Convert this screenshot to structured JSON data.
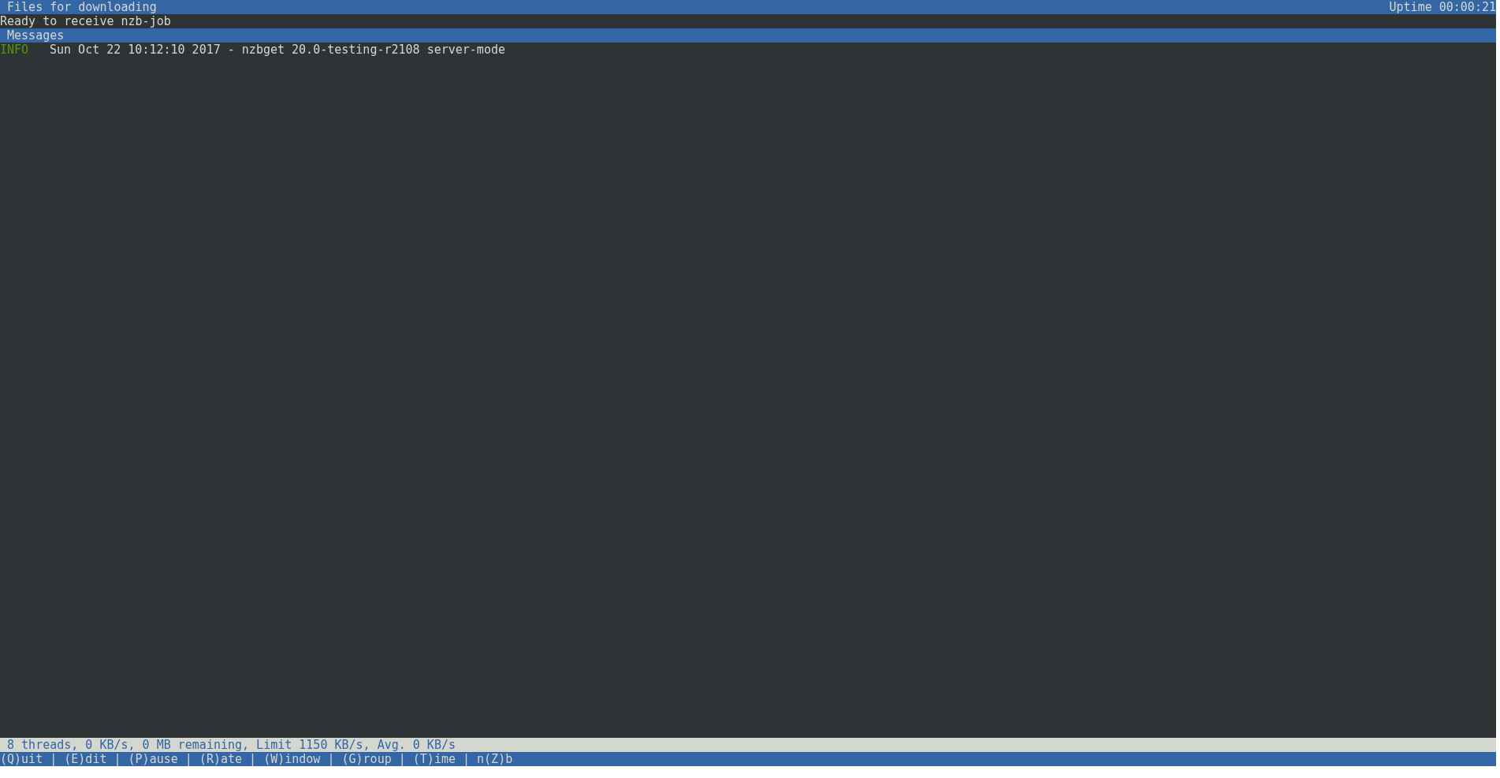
{
  "title_bar": {
    "title": "Files for downloading",
    "uptime": "Uptime 00:00:21"
  },
  "queue_status": "Ready to receive nzb-job",
  "messages": {
    "title": "Messages",
    "entries": [
      {
        "severity": "INFO",
        "color": "#4e9a06",
        "text": "Sun Oct 22 10:12:10 2017 - nzbget 20.0-testing-r2108 server-mode"
      }
    ]
  },
  "status_bar": "8 threads, 0 KB/s, 0 MB remaining, Limit 1150 KB/s, Avg. 0 KB/s",
  "key_bar": "(Q)uit | (E)dit | (P)ause | (R)ate | (W)indow | (G)roup | (T)ime | n(Z)b"
}
